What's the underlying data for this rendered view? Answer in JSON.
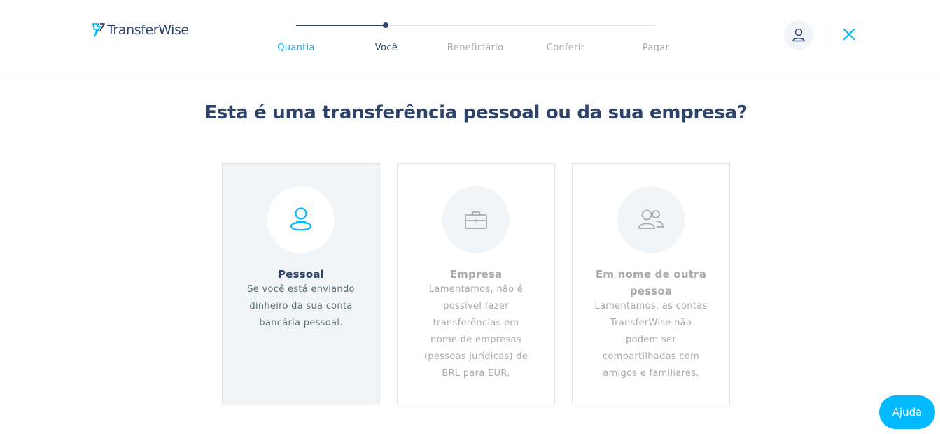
{
  "brand": {
    "name": "TransferWise",
    "accent": "#00b9ff",
    "navy": "#2e4369",
    "muted": "#a8aaac"
  },
  "stepper": {
    "steps": [
      {
        "label": "Quantia",
        "state": "done"
      },
      {
        "label": "Você",
        "state": "active"
      },
      {
        "label": "Beneficiário",
        "state": "pending"
      },
      {
        "label": "Conferir",
        "state": "pending"
      },
      {
        "label": "Pagar",
        "state": "pending"
      }
    ]
  },
  "header": {
    "profile_icon": "user-icon",
    "close_icon": "close-icon"
  },
  "main": {
    "title": "Esta é uma transferência pessoal ou da sua empresa?",
    "options": [
      {
        "title": "Pessoal",
        "description": "Se você está enviando dinheiro da sua conta bancária pessoal.",
        "icon": "person-icon",
        "selected": true
      },
      {
        "title": "Empresa",
        "description": "Lamentamos, não é possível fazer transferências em nome de empresas (pessoas jurídicas) de BRL para EUR.",
        "icon": "briefcase-icon",
        "selected": false
      },
      {
        "title": "Em nome de outra pessoa",
        "description": "Lamentamos, as contas TransferWise não podem ser compartilhadas com amigos e familiares.",
        "icon": "people-icon",
        "selected": false
      }
    ]
  },
  "help": {
    "label": "Ajuda"
  }
}
